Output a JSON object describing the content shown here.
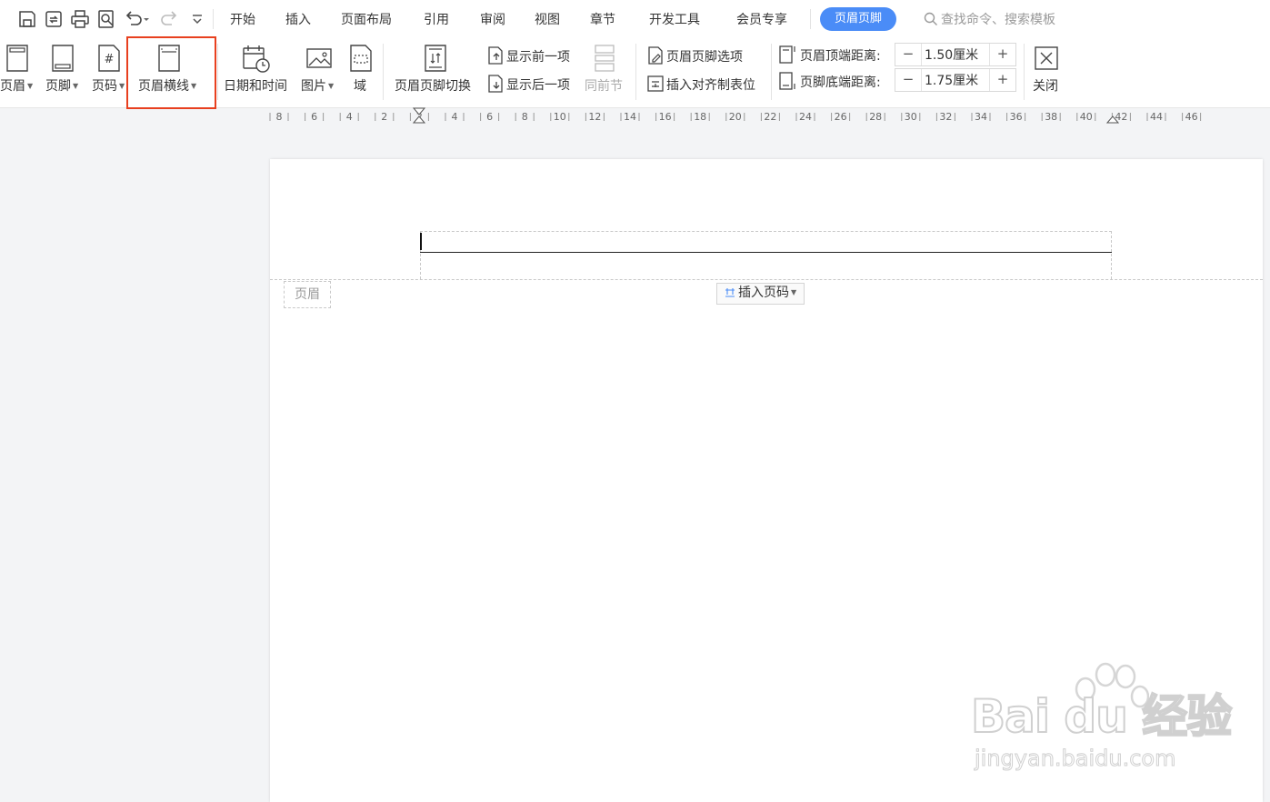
{
  "quick_access": [
    "save-icon",
    "cloud-sync-icon",
    "print-icon",
    "print-preview-icon",
    "undo-icon",
    "redo-icon",
    "customize-icon"
  ],
  "menu": {
    "tabs": [
      "开始",
      "插入",
      "页面布局",
      "引用",
      "审阅",
      "视图",
      "章节",
      "开发工具",
      "会员专享",
      "页眉页脚"
    ],
    "active_tab": "页眉页脚",
    "search_placeholder": "查找命令、搜索模板"
  },
  "ribbon": {
    "header": "页眉",
    "footer": "页脚",
    "page_number": "页码",
    "header_line": "页眉横线",
    "date_time": "日期和时间",
    "picture": "图片",
    "field": "域",
    "switch_header_footer": "页眉页脚切换",
    "show_previous": "显示前一项",
    "show_next": "显示后一项",
    "same_as_previous": "同前节",
    "header_footer_options": "页眉页脚选项",
    "insert_align_tab": "插入对齐制表位",
    "header_top_distance_label": "页眉顶端距离:",
    "header_top_distance_value": "1.50厘米",
    "footer_bottom_distance_label": "页脚底端距离:",
    "footer_bottom_distance_value": "1.75厘米",
    "spinner_minus": "−",
    "spinner_plus": "+",
    "close": "关闭"
  },
  "ruler": {
    "labels": [
      "8",
      "6",
      "4",
      "2",
      "2",
      "4",
      "6",
      "8",
      "10",
      "12",
      "14",
      "16",
      "18",
      "20",
      "22",
      "24",
      "26",
      "28",
      "30",
      "32",
      "34",
      "36",
      "38",
      "40",
      "42",
      "44",
      "46"
    ]
  },
  "document": {
    "header_tag": "页眉",
    "insert_page_number": "插入页码"
  },
  "watermark": {
    "logo": "Bai du 经验",
    "url": "jingyan.baidu.com"
  },
  "colors": {
    "accent": "#4a8cf7",
    "highlight_box": "#e8401f",
    "page_background": "#f3f4f6"
  }
}
